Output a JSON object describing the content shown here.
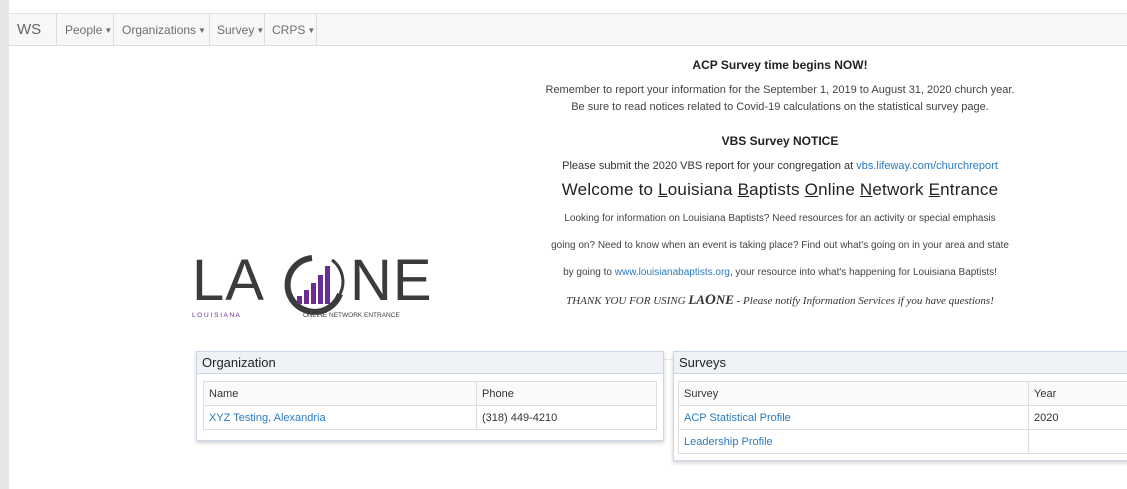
{
  "nav": {
    "brand": "WS",
    "items": [
      {
        "label": "People"
      },
      {
        "label": "Organizations"
      },
      {
        "label": "Survey"
      },
      {
        "label": "CRPS"
      }
    ]
  },
  "notices": {
    "acp_heading": "ACP Survey time begins NOW!",
    "acp_line1": "Remember to report your information for the September 1, 2019 to August 31, 2020 church year.",
    "acp_line2": "Be sure to read notices related to Covid-19 calculations on the statistical survey page.",
    "vbs_heading": "VBS Survey NOTICE",
    "vbs_text": "Please submit the 2020 VBS report for your congregation at ",
    "vbs_link": "vbs.lifeway.com/churchreport"
  },
  "welcome": {
    "parts": [
      "Welcome to ",
      "L",
      "ouisiana ",
      "B",
      "aptists ",
      "O",
      "nline ",
      "N",
      "etwork ",
      "E",
      "ntrance"
    ],
    "line1": "Looking for information on Louisiana Baptists? Need resources for an activity or special emphasis",
    "line2": "going on? Need to know when an event is taking place? Find out what's going on in your area and state",
    "line3_pre": "by going to ",
    "line3_link": "www.louisianabaptists.org",
    "line3_post": ", your resource into what's happening for Louisiana Baptists!",
    "thanks_pre": "THANK YOU FOR USING ",
    "thanks_la": "LA",
    "thanks_o": "O",
    "thanks_ne": "NE",
    "thanks_post": " - Please notify Information Services if you have questions!"
  },
  "logo": {
    "text_left": "LA",
    "text_right": "NE",
    "sub_left": "L O U I S I A N A",
    "sub_right": "ONLINE NETWORK ENTRANCE",
    "color_dark": "#3b3b3b",
    "color_purple": "#6b2c91"
  },
  "organization": {
    "title": "Organization",
    "columns": [
      "Name",
      "Phone"
    ],
    "rows": [
      {
        "name": "XYZ Testing, Alexandria",
        "phone": "(318) 449-4210"
      }
    ]
  },
  "surveys": {
    "title": "Surveys",
    "columns": [
      "Survey",
      "Year"
    ],
    "rows": [
      {
        "survey": "ACP Statistical Profile",
        "year": "2020"
      },
      {
        "survey": "Leadership Profile",
        "year": ""
      }
    ]
  },
  "colors": {
    "link": "#2a7bbf",
    "nav_bg": "#f7f7f7",
    "panel_head_bg": "#eef2f7"
  }
}
